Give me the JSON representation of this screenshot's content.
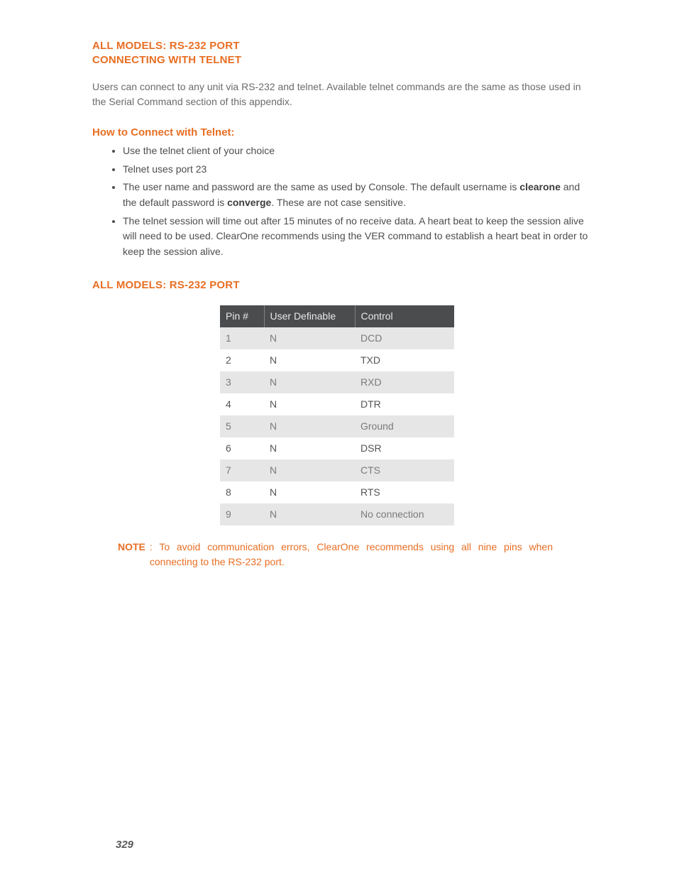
{
  "section1": {
    "title_line1": "ALL MODELS: RS-232 PORT",
    "title_line2": "CONNECTING WITH TELNET",
    "intro": "Users can connect to any unit via RS-232 and telnet. Available telnet commands are the same as those used in the Serial Command section of this appendix.",
    "sub_heading": "How to Connect with Telnet:",
    "bullets": {
      "b1": "Use the telnet client of your choice",
      "b2": "Telnet uses port 23",
      "b3_pre": "The user name and password are the same as used by Console. The default username is ",
      "b3_bold1": "clearone",
      "b3_mid": " and the default password is ",
      "b3_bold2": "converge",
      "b3_post": ". These are not case sensitive.",
      "b4": "The telnet session will time out after 15 minutes of no receive data. A heart beat to keep the session alive will need to be used. ClearOne recommends using the VER command to establish a heart beat in order to keep the session alive."
    }
  },
  "section2": {
    "title": "ALL MODELS: RS-232 PORT",
    "headers": {
      "h1": "Pin #",
      "h2": "User Definable",
      "h3": "Control"
    },
    "rows": [
      {
        "pin": "1",
        "ud": "N",
        "ctrl": "DCD"
      },
      {
        "pin": "2",
        "ud": "N",
        "ctrl": "TXD"
      },
      {
        "pin": "3",
        "ud": "N",
        "ctrl": "RXD"
      },
      {
        "pin": "4",
        "ud": "N",
        "ctrl": "DTR"
      },
      {
        "pin": "5",
        "ud": "N",
        "ctrl": "Ground"
      },
      {
        "pin": "6",
        "ud": "N",
        "ctrl": "DSR"
      },
      {
        "pin": "7",
        "ud": "N",
        "ctrl": "CTS"
      },
      {
        "pin": "8",
        "ud": "N",
        "ctrl": "RTS"
      },
      {
        "pin": "9",
        "ud": "N",
        "ctrl": "No connection"
      }
    ]
  },
  "note": {
    "label": "NOTE",
    "text": ": To avoid communication errors, ClearOne recommends using all nine pins when connecting to the RS-232 port."
  },
  "page_number": "329"
}
